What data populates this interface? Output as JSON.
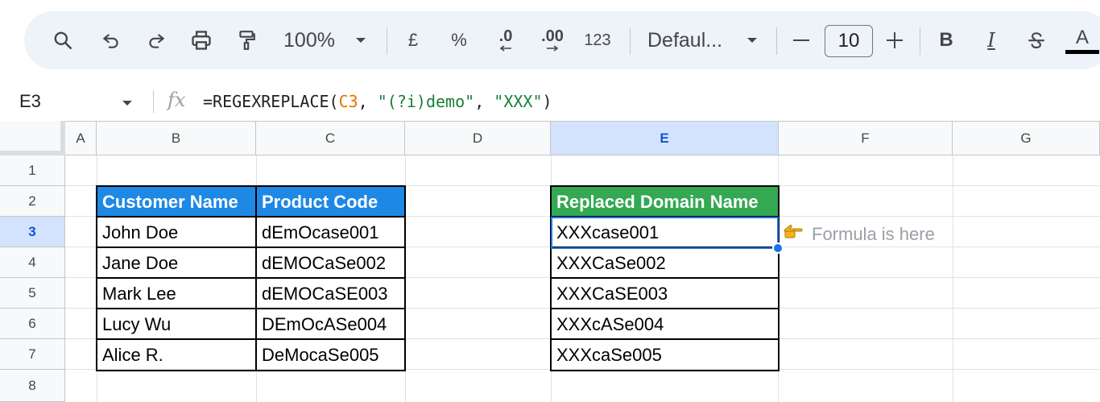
{
  "toolbar": {
    "zoom": "100%",
    "currency": "£",
    "percent": "%",
    "decrease_decimal": ".0",
    "increase_decimal": ".00",
    "number_format": "123",
    "font_family": "Defaul...",
    "font_size": "10",
    "bold": "B",
    "italic": "I",
    "text_color": "A",
    "icons": [
      "search-icon",
      "undo-icon",
      "redo-icon",
      "print-icon",
      "paint-format-icon",
      "chevron-down-icon",
      "minus-icon",
      "plus-icon",
      "strikethrough-icon"
    ]
  },
  "formula_bar": {
    "cell_ref": "E3",
    "fx": "fx",
    "formula_func": "=REGEXREPLACE(",
    "formula_ref": "C3",
    "formula_sep1": ", ",
    "formula_str1": "\"(?i)demo\"",
    "formula_sep2": ", ",
    "formula_str2": "\"XXX\"",
    "formula_close": ")"
  },
  "columns": [
    "A",
    "B",
    "C",
    "D",
    "E",
    "F",
    "G"
  ],
  "rows": [
    "1",
    "2",
    "3",
    "4",
    "5",
    "6",
    "7",
    "8"
  ],
  "selected_column": "E",
  "selected_row": "3",
  "table": {
    "headers": [
      "Customer Name",
      "Product Code"
    ],
    "rows": [
      [
        "John Doe",
        "dEmOcase001"
      ],
      [
        "Jane Doe",
        "dEMOCaSe002"
      ],
      [
        "Mark Lee",
        "dEMOCaSE003"
      ],
      [
        "Lucy Wu",
        "DEmOcASe004"
      ],
      [
        "Alice R.",
        "DeMocaSe005"
      ]
    ]
  },
  "result": {
    "header": "Replaced Domain Name",
    "values": [
      "XXXcase001",
      "XXXCaSe002",
      "XXXCaSE003",
      "XXXcASe004",
      "XXXcaSe005"
    ]
  },
  "note": {
    "icon": "pointing-hand-icon",
    "text": "Formula is here"
  },
  "colors": {
    "blue_header": "#1e88e5",
    "green_header": "#34a853",
    "selection": "#1a73e8",
    "toolbar_bg": "#eef2f9"
  }
}
